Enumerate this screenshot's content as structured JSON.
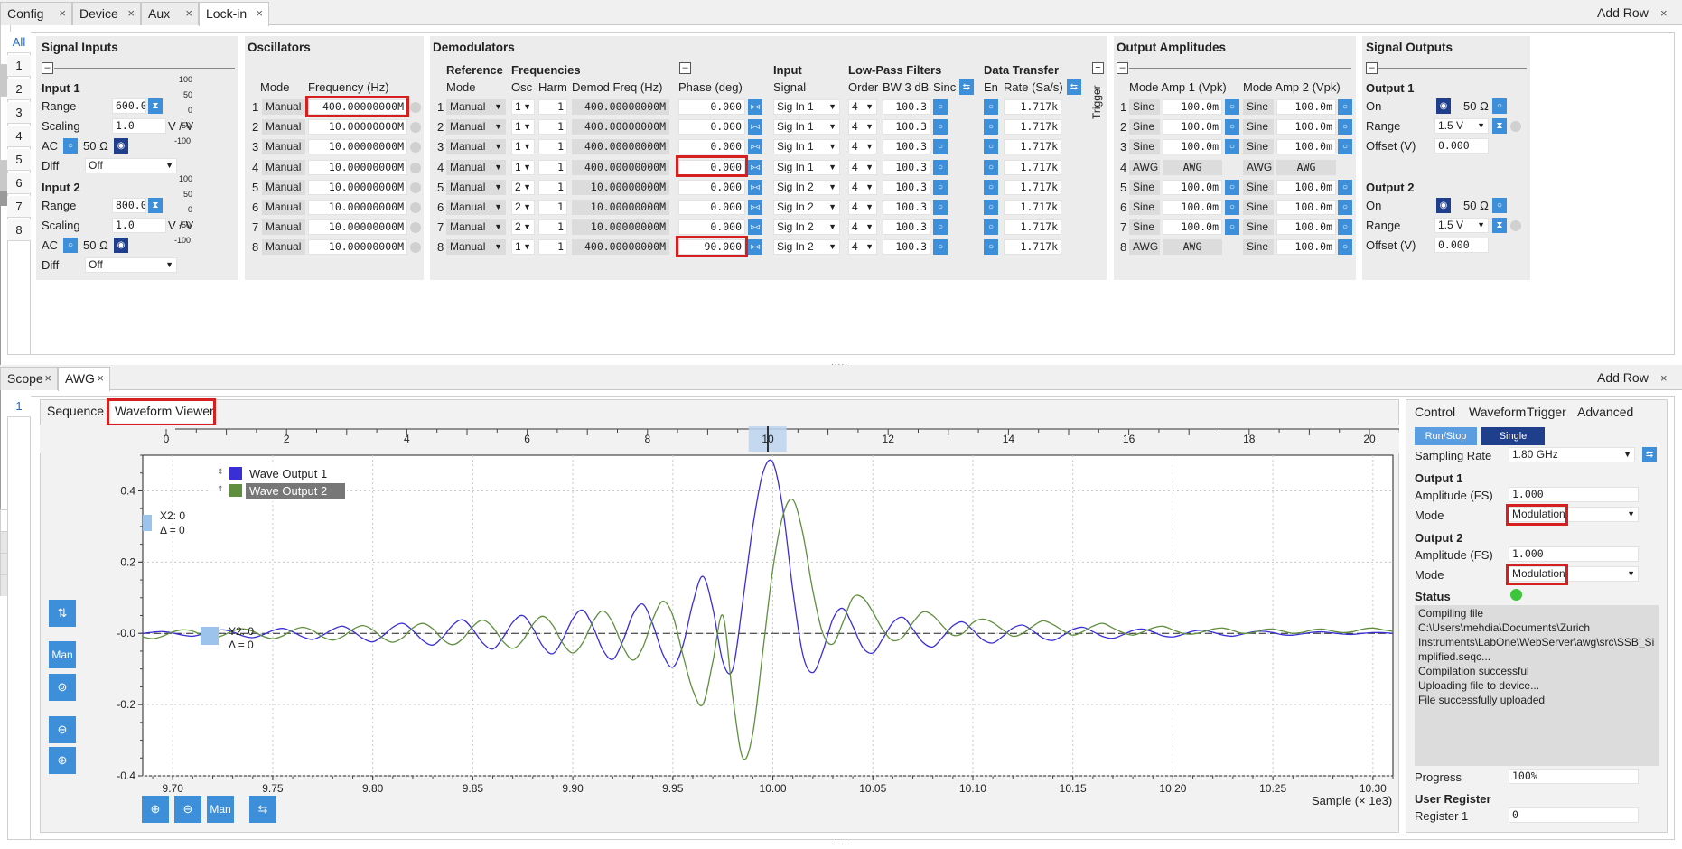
{
  "top_tabs": [
    {
      "label": "Config",
      "x": 0,
      "w": 80,
      "active": false
    },
    {
      "label": "Device",
      "x": 80,
      "w": 76,
      "active": false
    },
    {
      "label": "Aux",
      "x": 156,
      "w": 64,
      "active": false
    },
    {
      "label": "Lock-in",
      "x": 220,
      "w": 78,
      "active": true
    }
  ],
  "top_addrow": "Add Row",
  "top_vtabs": [
    "All",
    "1",
    "2",
    "3",
    "4",
    "5",
    "6",
    "7",
    "8"
  ],
  "signal_inputs": {
    "title": "Signal Inputs",
    "input1": "Input 1",
    "input2": "Input 2",
    "range_label": "Range",
    "scaling_label": "Scaling",
    "ac_label": "AC",
    "diff_label": "Diff",
    "range1": "600.0m",
    "range2": "800.0m",
    "scaling1": "1.0",
    "scaling2": "1.0",
    "unit": "V / V",
    "ohm": "50 Ω",
    "diff1": "Off",
    "diff2": "Off",
    "gauge": [
      "100",
      "50",
      "0",
      "-50",
      "-100"
    ]
  },
  "oscillators": {
    "title": "Oscillators",
    "mode_header": "Mode",
    "freq_header": "Frequency (Hz)",
    "rows": [
      {
        "n": "1",
        "mode": "Manual",
        "freq": "400.00000000M"
      },
      {
        "n": "2",
        "mode": "Manual",
        "freq": "10.00000000M"
      },
      {
        "n": "3",
        "mode": "Manual",
        "freq": "10.00000000M"
      },
      {
        "n": "4",
        "mode": "Manual",
        "freq": "10.00000000M"
      },
      {
        "n": "5",
        "mode": "Manual",
        "freq": "10.00000000M"
      },
      {
        "n": "6",
        "mode": "Manual",
        "freq": "10.00000000M"
      },
      {
        "n": "7",
        "mode": "Manual",
        "freq": "10.00000000M"
      },
      {
        "n": "8",
        "mode": "Manual",
        "freq": "10.00000000M"
      }
    ]
  },
  "demodulators": {
    "title": "Demodulators",
    "reference": "Reference",
    "frequencies": "Frequencies",
    "mode": "Mode",
    "osc": "Osc",
    "harm": "Harm",
    "demod_freq": "Demod Freq (Hz)",
    "phase": "Phase (deg)",
    "input": "Input",
    "signal": "Signal",
    "lowpass": "Low-Pass Filters",
    "order": "Order",
    "bw": "BW 3 dB",
    "sinc": "Sinc",
    "transfer": "Data Transfer",
    "en": "En",
    "rate": "Rate (Sa/s)",
    "trigger": "Trigger",
    "rows": [
      {
        "n": "1",
        "mode": "Manual",
        "osc": "1",
        "harm": "1",
        "freq": "400.00000000M",
        "phase": "0.000",
        "sig": "Sig In 1",
        "order": "4",
        "bw": "100.3",
        "rate": "1.717k"
      },
      {
        "n": "2",
        "mode": "Manual",
        "osc": "1",
        "harm": "1",
        "freq": "400.00000000M",
        "phase": "0.000",
        "sig": "Sig In 1",
        "order": "4",
        "bw": "100.3",
        "rate": "1.717k"
      },
      {
        "n": "3",
        "mode": "Manual",
        "osc": "1",
        "harm": "1",
        "freq": "400.00000000M",
        "phase": "0.000",
        "sig": "Sig In 1",
        "order": "4",
        "bw": "100.3",
        "rate": "1.717k"
      },
      {
        "n": "4",
        "mode": "Manual",
        "osc": "1",
        "harm": "1",
        "freq": "400.00000000M",
        "phase": "0.000",
        "sig": "Sig In 1",
        "order": "4",
        "bw": "100.3",
        "rate": "1.717k"
      },
      {
        "n": "5",
        "mode": "Manual",
        "osc": "2",
        "harm": "1",
        "freq": "10.00000000M",
        "phase": "0.000",
        "sig": "Sig In 2",
        "order": "4",
        "bw": "100.3",
        "rate": "1.717k"
      },
      {
        "n": "6",
        "mode": "Manual",
        "osc": "2",
        "harm": "1",
        "freq": "10.00000000M",
        "phase": "0.000",
        "sig": "Sig In 2",
        "order": "4",
        "bw": "100.3",
        "rate": "1.717k"
      },
      {
        "n": "7",
        "mode": "Manual",
        "osc": "2",
        "harm": "1",
        "freq": "10.00000000M",
        "phase": "0.000",
        "sig": "Sig In 2",
        "order": "4",
        "bw": "100.3",
        "rate": "1.717k"
      },
      {
        "n": "8",
        "mode": "Manual",
        "osc": "1",
        "harm": "1",
        "freq": "400.00000000M",
        "phase": "90.000",
        "sig": "Sig In 2",
        "order": "4",
        "bw": "100.3",
        "rate": "1.717k"
      }
    ]
  },
  "output_amplitudes": {
    "title": "Output Amplitudes",
    "mode_amp1": "Mode Amp 1 (Vpk)",
    "mode_amp2": "Mode Amp 2 (Vpk)",
    "rows": [
      {
        "n": "1",
        "m1": "Sine",
        "a1": "100.0m",
        "m2": "Sine",
        "a2": "100.0m"
      },
      {
        "n": "2",
        "m1": "Sine",
        "a1": "100.0m",
        "m2": "Sine",
        "a2": "100.0m"
      },
      {
        "n": "3",
        "m1": "Sine",
        "a1": "100.0m",
        "m2": "Sine",
        "a2": "100.0m"
      },
      {
        "n": "4",
        "m1": "AWG",
        "a1": "AWG",
        "m2": "AWG",
        "a2": "AWG"
      },
      {
        "n": "5",
        "m1": "Sine",
        "a1": "100.0m",
        "m2": "Sine",
        "a2": "100.0m"
      },
      {
        "n": "6",
        "m1": "Sine",
        "a1": "100.0m",
        "m2": "Sine",
        "a2": "100.0m"
      },
      {
        "n": "7",
        "m1": "Sine",
        "a1": "100.0m",
        "m2": "Sine",
        "a2": "100.0m"
      },
      {
        "n": "8",
        "m1": "AWG",
        "a1": "AWG",
        "m2": "Sine",
        "a2": "100.0m"
      }
    ]
  },
  "signal_outputs": {
    "title": "Signal Outputs",
    "output1": "Output 1",
    "output2": "Output 2",
    "on": "On",
    "range": "Range",
    "offset": "Offset (V)",
    "ohm": "50 Ω",
    "range1": "1.5 V",
    "range2": "1.5 V",
    "offset1": "0.000",
    "offset2": "0.000"
  },
  "bottom_tabs": [
    {
      "label": "Scope",
      "x": 0,
      "w": 64,
      "active": false
    },
    {
      "label": "AWG",
      "x": 64,
      "w": 58,
      "active": true
    }
  ],
  "bottom_addrow": "Add Row",
  "bottom_vtab": "1",
  "awg_subtabs": {
    "sequence": "Sequence",
    "viewer": "Waveform Viewer"
  },
  "control": {
    "tabs": [
      "Control",
      "Waveform",
      "Trigger",
      "Advanced"
    ],
    "run_stop": "Run/Stop",
    "single": "Single",
    "sampling_rate_label": "Sampling Rate",
    "sampling_rate": "1.80 GHz",
    "output1": "Output 1",
    "output2": "Output 2",
    "amp_label": "Amplitude (FS)",
    "amp1": "1.000",
    "amp2": "1.000",
    "mode_label": "Mode",
    "mode1": "Modulation",
    "mode2": "Modulation",
    "status_label": "Status",
    "status_lines": [
      "Compiling file",
      "C:\\Users\\mehdia\\Documents\\Zurich",
      "Instruments\\LabOne\\WebServer\\awg\\src\\SSB_Si",
      "mplified.seqc...",
      "Compilation successful",
      "Uploading file to device...",
      "File successfully uploaded"
    ],
    "progress_label": "Progress",
    "progress": "100%",
    "user_register": "User Register",
    "register1_label": "Register 1",
    "register1": "0"
  },
  "plot_text": {
    "legend1": "Wave Output 1",
    "legend2": "Wave Output 2",
    "x2": "X2: 0",
    "dx": "Δ = 0",
    "y2": "Y2: 0",
    "dy": "Δ = 0",
    "xlabel": "Sample (× 1e3)",
    "man": "Man"
  },
  "colors": {
    "wave1": "#3a2fd6",
    "wave2": "#5f8f3e",
    "accent": "#3d8fd9",
    "highlight": "#d62020"
  },
  "chart_data": {
    "type": "line",
    "xlabel": "Sample (× 1e3)",
    "xlim": [
      9.685,
      10.31
    ],
    "ylim": [
      -0.4,
      0.5
    ],
    "x_ticks": [
      9.7,
      9.75,
      9.8,
      9.85,
      9.9,
      9.95,
      10.0,
      10.05,
      10.1,
      10.15,
      10.2,
      10.25,
      10.3
    ],
    "x_tick_labels": [
      "9.70",
      "9.75",
      "9.80",
      "9.85",
      "9.90",
      "9.95",
      "10.00",
      "10.05",
      "10.10",
      "10.15",
      "10.20",
      "10.25",
      "10.30"
    ],
    "y_ticks": [
      -0.4,
      -0.2,
      0.0,
      0.2,
      0.4
    ],
    "y_tick_labels": [
      "-0.4",
      "-0.2",
      "-0.0",
      "0.2",
      "0.4"
    ],
    "overview_ticks": [
      0,
      2,
      4,
      6,
      8,
      10,
      12,
      14,
      16,
      18,
      20
    ],
    "overview_labels": [
      "0",
      "2",
      "4",
      "6",
      "8",
      "10",
      "12",
      "14",
      "16",
      "18",
      "20"
    ],
    "series": [
      {
        "name": "Wave Output 1",
        "x": [
          9.685,
          9.69,
          9.695,
          9.7,
          9.705,
          9.71,
          9.715,
          9.72,
          9.725,
          9.73,
          9.735,
          9.74,
          9.745,
          9.75,
          9.755,
          9.76,
          9.765,
          9.77,
          9.775,
          9.78,
          9.785,
          9.79,
          9.795,
          9.8,
          9.805,
          9.81,
          9.815,
          9.82,
          9.825,
          9.83,
          9.835,
          9.84,
          9.845,
          9.85,
          9.855,
          9.86,
          9.865,
          9.87,
          9.875,
          9.88,
          9.885,
          9.89,
          9.895,
          9.9,
          9.905,
          9.91,
          9.915,
          9.92,
          9.925,
          9.93,
          9.935,
          9.94,
          9.945,
          9.95,
          9.955,
          9.96,
          9.965,
          9.97,
          9.975,
          9.98,
          9.985,
          9.99,
          9.995,
          10.0,
          10.005,
          10.01,
          10.015,
          10.02,
          10.025,
          10.03,
          10.035,
          10.04,
          10.045,
          10.05,
          10.055,
          10.06,
          10.065,
          10.07,
          10.075,
          10.08,
          10.085,
          10.09,
          10.095,
          10.1,
          10.105,
          10.11,
          10.115,
          10.12,
          10.125,
          10.13,
          10.135,
          10.14,
          10.145,
          10.15,
          10.155,
          10.16,
          10.165,
          10.17,
          10.175,
          10.18,
          10.185,
          10.19,
          10.195,
          10.2,
          10.205,
          10.21,
          10.215,
          10.22,
          10.225,
          10.23,
          10.235,
          10.24,
          10.245,
          10.25,
          10.255,
          10.26,
          10.265,
          10.27,
          10.275,
          10.28,
          10.285,
          10.29,
          10.295,
          10.3,
          10.305,
          10.31
        ],
        "y": [
          0.0,
          0.003,
          0.005,
          0.001,
          -0.005,
          -0.008,
          -0.002,
          0.006,
          0.01,
          0.004,
          -0.007,
          -0.012,
          -0.004,
          0.008,
          0.014,
          0.004,
          -0.01,
          -0.017,
          -0.005,
          0.011,
          0.02,
          0.006,
          -0.014,
          -0.024,
          -0.007,
          0.017,
          0.028,
          0.008,
          -0.02,
          -0.033,
          -0.01,
          0.023,
          0.038,
          0.011,
          -0.027,
          -0.044,
          -0.013,
          0.031,
          0.05,
          0.015,
          -0.036,
          -0.057,
          -0.017,
          0.041,
          0.065,
          0.02,
          -0.046,
          -0.073,
          -0.022,
          0.052,
          0.082,
          0.025,
          -0.058,
          -0.095,
          -0.035,
          0.085,
          0.16,
          0.07,
          -0.08,
          -0.1,
          0.09,
          0.3,
          0.45,
          0.48,
          0.35,
          0.12,
          -0.06,
          -0.11,
          -0.05,
          0.04,
          0.07,
          0.02,
          -0.04,
          -0.055,
          -0.015,
          0.03,
          0.045,
          0.012,
          -0.025,
          -0.038,
          -0.01,
          0.021,
          0.032,
          0.009,
          -0.018,
          -0.027,
          -0.008,
          0.015,
          0.023,
          0.007,
          -0.013,
          -0.02,
          -0.006,
          0.011,
          0.017,
          0.005,
          -0.009,
          -0.014,
          -0.004,
          0.008,
          0.012,
          0.004,
          -0.007,
          -0.01,
          -0.003,
          0.006,
          0.009,
          0.003,
          -0.005,
          -0.008,
          -0.002,
          0.004,
          0.006,
          0.002,
          -0.004,
          -0.005,
          -0.001,
          0.003,
          0.004,
          0.001,
          -0.002,
          -0.003,
          0.0,
          0.002,
          0.002,
          0.0
        ]
      },
      {
        "name": "Wave Output 2",
        "x": [
          9.685,
          9.69,
          9.695,
          9.7,
          9.705,
          9.71,
          9.715,
          9.72,
          9.725,
          9.73,
          9.735,
          9.74,
          9.745,
          9.75,
          9.755,
          9.76,
          9.765,
          9.77,
          9.775,
          9.78,
          9.785,
          9.79,
          9.795,
          9.8,
          9.805,
          9.81,
          9.815,
          9.82,
          9.825,
          9.83,
          9.835,
          9.84,
          9.845,
          9.85,
          9.855,
          9.86,
          9.865,
          9.87,
          9.875,
          9.88,
          9.885,
          9.89,
          9.895,
          9.9,
          9.905,
          9.91,
          9.915,
          9.92,
          9.925,
          9.93,
          9.935,
          9.94,
          9.945,
          9.95,
          9.955,
          9.96,
          9.965,
          9.97,
          9.975,
          9.98,
          9.985,
          9.99,
          9.995,
          10.0,
          10.005,
          10.01,
          10.015,
          10.02,
          10.025,
          10.03,
          10.035,
          10.04,
          10.045,
          10.05,
          10.055,
          10.06,
          10.065,
          10.07,
          10.075,
          10.08,
          10.085,
          10.09,
          10.095,
          10.1,
          10.105,
          10.11,
          10.115,
          10.12,
          10.125,
          10.13,
          10.135,
          10.14,
          10.145,
          10.15,
          10.155,
          10.16,
          10.165,
          10.17,
          10.175,
          10.18,
          10.185,
          10.19,
          10.195,
          10.2,
          10.205,
          10.21,
          10.215,
          10.22,
          10.225,
          10.23,
          10.235,
          10.24,
          10.245,
          10.25,
          10.255,
          10.26,
          10.265,
          10.27,
          10.275,
          10.28,
          10.285,
          10.29,
          10.295,
          10.3,
          10.305,
          10.31
        ],
        "y": [
          -0.01,
          -0.015,
          -0.008,
          0.004,
          0.01,
          0.006,
          -0.006,
          -0.012,
          -0.006,
          0.007,
          0.013,
          0.006,
          -0.008,
          -0.015,
          -0.007,
          0.009,
          0.017,
          0.008,
          -0.01,
          -0.019,
          -0.009,
          0.011,
          0.022,
          0.01,
          -0.013,
          -0.025,
          -0.012,
          0.015,
          0.028,
          0.013,
          -0.017,
          -0.032,
          -0.015,
          0.019,
          0.037,
          0.017,
          -0.022,
          -0.042,
          -0.02,
          0.025,
          0.048,
          0.022,
          -0.028,
          -0.055,
          -0.026,
          0.032,
          0.063,
          0.03,
          -0.037,
          -0.075,
          -0.04,
          0.04,
          0.09,
          0.05,
          -0.06,
          -0.16,
          -0.2,
          -0.08,
          0.05,
          -0.18,
          -0.35,
          -0.28,
          -0.05,
          0.18,
          0.33,
          0.375,
          0.28,
          0.12,
          0.0,
          -0.03,
          0.03,
          0.1,
          0.1,
          0.06,
          0.01,
          -0.02,
          -0.01,
          0.03,
          0.06,
          0.05,
          0.02,
          -0.005,
          0.0,
          0.03,
          0.04,
          0.03,
          0.01,
          -0.008,
          0.0,
          0.02,
          0.035,
          0.025,
          0.008,
          -0.005,
          0.005,
          0.02,
          0.028,
          0.015,
          0.002,
          -0.005,
          0.004,
          0.015,
          0.02,
          0.01,
          0.0,
          -0.002,
          0.004,
          0.012,
          0.015,
          0.008,
          0.0,
          0.002,
          0.01,
          0.012,
          0.006,
          0.0,
          0.003,
          0.01,
          0.012,
          0.006,
          0.002,
          0.005,
          0.012,
          0.015,
          0.01,
          0.006
        ]
      }
    ]
  }
}
